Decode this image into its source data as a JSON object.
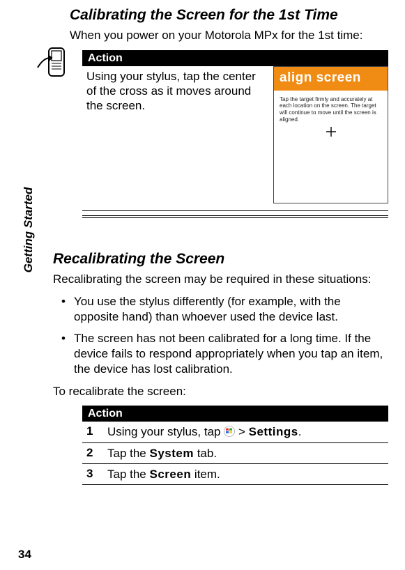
{
  "sideTab": "Getting Started",
  "sec1": {
    "title": "Calibrating the Screen for the 1st Time",
    "intro": "When you power on your Motorola MPx for the 1st time:",
    "actionHeader": "Action",
    "actionText": "Using your stylus, tap the center of the cross as it moves around the screen.",
    "alignTitle": "align screen",
    "alignInst": "Tap the target firmly and accurately at each location on the screen. The target will continue to move until the screen is aligned."
  },
  "sec2": {
    "title": "Recalibrating the Screen",
    "intro": "Recalibrating the screen may be required in these situations:",
    "bullet1": "You use the stylus differently (for example, with the opposite hand) than whoever used the device last.",
    "bullet2": "The screen has not been calibrated for a long time. If the device fails to respond appropriately when you tap an item, the device has lost calibration.",
    "lead2": "To recalibrate the screen:",
    "actionHeader": "Action",
    "step1a": "Using your stylus, tap ",
    "step1b": " > ",
    "step1settings": "Settings",
    "step1c": ".",
    "step2a": "Tap the ",
    "step2system": "System",
    "step2b": " tab.",
    "step3a": "Tap the ",
    "step3screen": "Screen",
    "step3b": " item.",
    "n1": "1",
    "n2": "2",
    "n3": "3"
  },
  "pageNum": "34"
}
